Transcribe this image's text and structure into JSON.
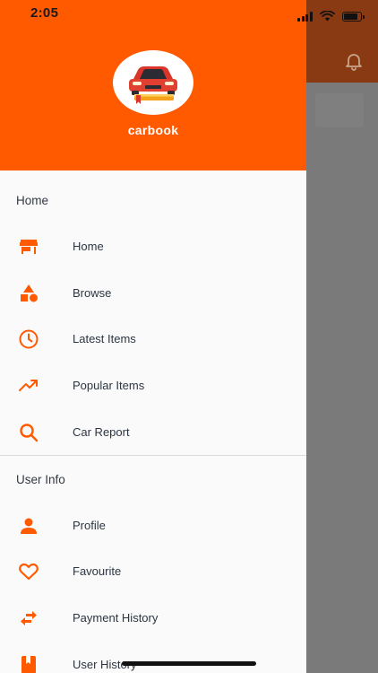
{
  "status": {
    "time": "2:05"
  },
  "colors": {
    "accent": "#ff5a00",
    "header_dim": "#8a3a12",
    "text": "#2c3542"
  },
  "brand": {
    "name": "carbook"
  },
  "sections": {
    "home": {
      "title": "Home"
    },
    "user_info": {
      "title": "User Info"
    }
  },
  "menu": {
    "home": {
      "label": "Home",
      "icon": "store-icon"
    },
    "browse": {
      "label": "Browse",
      "icon": "shapes-icon"
    },
    "latest": {
      "label": "Latest Items",
      "icon": "clock-icon"
    },
    "popular": {
      "label": "Popular Items",
      "icon": "trending-up-icon"
    },
    "car_report": {
      "label": "Car Report",
      "icon": "search-icon"
    },
    "profile": {
      "label": "Profile",
      "icon": "person-icon"
    },
    "favourite": {
      "label": "Favourite",
      "icon": "heart-icon"
    },
    "payment_history": {
      "label": "Payment History",
      "icon": "swap-icon"
    },
    "user_history": {
      "label": "User History",
      "icon": "book-icon"
    }
  }
}
